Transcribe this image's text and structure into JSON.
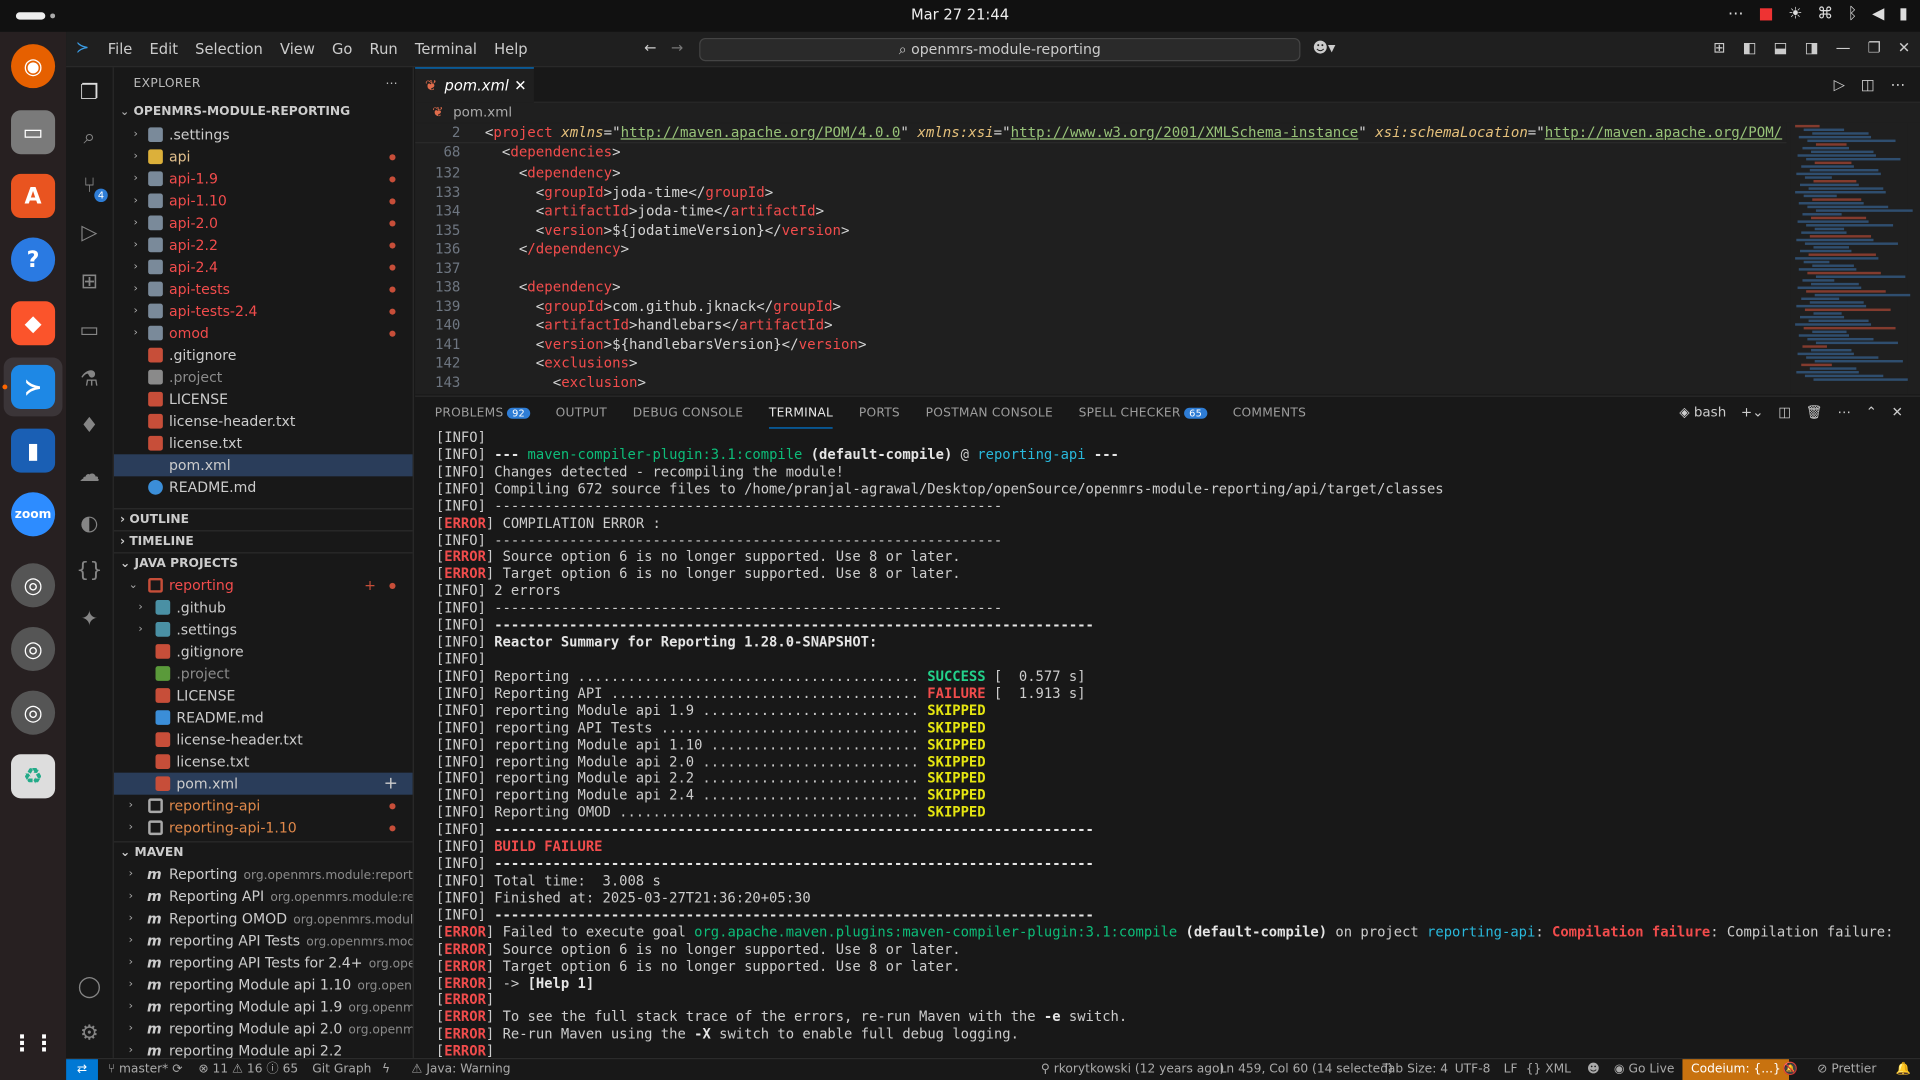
{
  "topbar": {
    "clock": "Mar 27  21:44",
    "tray_icons": [
      "more-icon",
      "record-icon",
      "brightness-icon",
      "network-icon",
      "bluetooth-icon",
      "volume-icon",
      "battery-icon"
    ]
  },
  "titlebar": {
    "menu": [
      "File",
      "Edit",
      "Selection",
      "View",
      "Go",
      "Run",
      "Terminal",
      "Help"
    ],
    "search": "openmrs-module-reporting"
  },
  "explorer": {
    "header": "EXPLORER",
    "root": "OPENMRS-MODULE-REPORTING",
    "items": [
      ".settings",
      "api",
      "api-1.9",
      "api-1.10",
      "api-2.0",
      "api-2.2",
      "api-2.4",
      "api-tests",
      "api-tests-2.4",
      "omod",
      ".gitignore",
      ".project",
      "LICENSE",
      "license-header.txt",
      "license.txt",
      "pom.xml",
      "README.md"
    ]
  },
  "sections": {
    "outline": "OUTLINE",
    "timeline": "TIMELINE",
    "java": "JAVA PROJECTS",
    "maven": "MAVEN"
  },
  "java_projects": {
    "reporting": "reporting",
    "children": [
      ".github",
      ".settings",
      ".gitignore",
      ".project",
      "LICENSE",
      "README.md",
      "license-header.txt",
      "license.txt",
      "pom.xml"
    ],
    "others": [
      "reporting-api",
      "reporting-api-1.10"
    ]
  },
  "maven": [
    {
      "name": "Reporting",
      "sub": "org.openmrs.module:reporting"
    },
    {
      "name": "Reporting API",
      "sub": "org.openmrs.module:rep..."
    },
    {
      "name": "Reporting OMOD",
      "sub": "org.openmrs.module..."
    },
    {
      "name": "reporting API Tests",
      "sub": "org.openmrs.modu..."
    },
    {
      "name": "reporting API Tests for 2.4+",
      "sub": "org.open..."
    },
    {
      "name": "reporting Module api 1.10",
      "sub": "org.openmr..."
    },
    {
      "name": "reporting Module api 1.9",
      "sub": "org.openmrs..."
    },
    {
      "name": "reporting Module api 2.0",
      "sub": "org.openmrs..."
    },
    {
      "name": "reporting Module api 2.2",
      "sub": ""
    }
  ],
  "editor": {
    "tab": "pom.xml",
    "breadcrumb": "pom.xml",
    "line2": {
      "n": "2",
      "tag": "project",
      "a1": "xmlns",
      "v1": "http://maven.apache.org/POM/4.0.0",
      "a2": "xmlns:xsi",
      "v2": "http://www.w3.org/2001/XMLSchema-instance",
      "a3": "xsi:schemaLocation",
      "v3": "http://maven.apache.org/POM/"
    },
    "lines": [
      {
        "n": "68",
        "indent": "  ",
        "tag": "dependencies",
        "text": "",
        "close": ""
      },
      {
        "n": "132",
        "indent": "    ",
        "tag": "dependency",
        "text": "",
        "close": ""
      },
      {
        "n": "133",
        "indent": "      ",
        "tag": "groupId",
        "text": "joda-time",
        "close": "groupId"
      },
      {
        "n": "134",
        "indent": "      ",
        "tag": "artifactId",
        "text": "joda-time",
        "close": "artifactId"
      },
      {
        "n": "135",
        "indent": "      ",
        "tag": "version",
        "text": "${jodatimeVersion}",
        "close": "version"
      },
      {
        "n": "136",
        "indent": "    ",
        "tag": "/dependency",
        "text": "",
        "close": ""
      },
      {
        "n": "137",
        "indent": "",
        "tag": "",
        "text": "",
        "close": ""
      },
      {
        "n": "138",
        "indent": "    ",
        "tag": "dependency",
        "text": "",
        "close": ""
      },
      {
        "n": "139",
        "indent": "      ",
        "tag": "groupId",
        "text": "com.github.jknack",
        "close": "groupId"
      },
      {
        "n": "140",
        "indent": "      ",
        "tag": "artifactId",
        "text": "handlebars",
        "close": "artifactId"
      },
      {
        "n": "141",
        "indent": "      ",
        "tag": "version",
        "text": "${handlebarsVersion}",
        "close": "version"
      },
      {
        "n": "142",
        "indent": "      ",
        "tag": "exclusions",
        "text": "",
        "close": ""
      },
      {
        "n": "143",
        "indent": "        ",
        "tag": "exclusion",
        "text": "",
        "close": ""
      }
    ]
  },
  "panel": {
    "tabs": [
      "PROBLEMS",
      "OUTPUT",
      "DEBUG CONSOLE",
      "TERMINAL",
      "PORTS",
      "POSTMAN CONSOLE",
      "SPELL CHECKER",
      "COMMENTS"
    ],
    "problems_count": "92",
    "spell_count": "65",
    "shell": "bash"
  },
  "terminal": [
    [
      [
        "",
        "[INFO]"
      ]
    ],
    [
      [
        "",
        "[INFO] "
      ],
      [
        "tB",
        "--- "
      ],
      [
        "tgr",
        "maven-compiler-plugin:3.1:compile"
      ],
      [
        "tB",
        " (default-compile)"
      ],
      [
        "",
        " @ "
      ],
      [
        "tC",
        "reporting-api"
      ],
      [
        "tB",
        " ---"
      ]
    ],
    [
      [
        "",
        "[INFO] Changes detected - recompiling the module!"
      ]
    ],
    [
      [
        "",
        "[INFO] Compiling 672 source files to /home/pranjal-agrawal/Desktop/openSource/openmrs-module-reporting/api/target/classes"
      ]
    ],
    [
      [
        "",
        "[INFO] -------------------------------------------------------------"
      ]
    ],
    [
      [
        "",
        "["
      ],
      [
        "tR",
        "ERROR"
      ],
      [
        "",
        "] COMPILATION ERROR :"
      ]
    ],
    [
      [
        "",
        "[INFO] -------------------------------------------------------------"
      ]
    ],
    [
      [
        "",
        "["
      ],
      [
        "tR",
        "ERROR"
      ],
      [
        "",
        "] Source option 6 is no longer supported. Use 8 or later."
      ]
    ],
    [
      [
        "",
        "["
      ],
      [
        "tR",
        "ERROR"
      ],
      [
        "",
        "] Target option 6 is no longer supported. Use 8 or later."
      ]
    ],
    [
      [
        "",
        "[INFO] 2 errors"
      ]
    ],
    [
      [
        "",
        "[INFO] -------------------------------------------------------------"
      ]
    ],
    [
      [
        "",
        "[INFO] "
      ],
      [
        "tB",
        "------------------------------------------------------------------------"
      ]
    ],
    [
      [
        "",
        "[INFO] "
      ],
      [
        "tB",
        "Reactor Summary for Reporting 1.28.0-SNAPSHOT:"
      ]
    ],
    [
      [
        "",
        "[INFO]"
      ]
    ],
    [
      [
        "",
        "[INFO] Reporting ......................................... "
      ],
      [
        "tG",
        "SUCCESS"
      ],
      [
        "",
        " [  0.577 s]"
      ]
    ],
    [
      [
        "",
        "[INFO] Reporting API ..................................... "
      ],
      [
        "tR",
        "FAILURE"
      ],
      [
        "",
        " [  1.913 s]"
      ]
    ],
    [
      [
        "",
        "[INFO] reporting Module api 1.9 .......................... "
      ],
      [
        "tY",
        "SKIPPED"
      ]
    ],
    [
      [
        "",
        "[INFO] reporting API Tests ............................... "
      ],
      [
        "tY",
        "SKIPPED"
      ]
    ],
    [
      [
        "",
        "[INFO] reporting Module api 1.10 ......................... "
      ],
      [
        "tY",
        "SKIPPED"
      ]
    ],
    [
      [
        "",
        "[INFO] reporting Module api 2.0 .......................... "
      ],
      [
        "tY",
        "SKIPPED"
      ]
    ],
    [
      [
        "",
        "[INFO] reporting Module api 2.2 .......................... "
      ],
      [
        "tY",
        "SKIPPED"
      ]
    ],
    [
      [
        "",
        "[INFO] reporting Module api 2.4 .......................... "
      ],
      [
        "tY",
        "SKIPPED"
      ]
    ],
    [
      [
        "",
        "[INFO] Reporting OMOD .................................... "
      ],
      [
        "tY",
        "SKIPPED"
      ]
    ],
    [
      [
        "",
        "[INFO] "
      ],
      [
        "tB",
        "------------------------------------------------------------------------"
      ]
    ],
    [
      [
        "",
        "[INFO] "
      ],
      [
        "tR",
        "BUILD FAILURE"
      ]
    ],
    [
      [
        "",
        "[INFO] "
      ],
      [
        "tB",
        "------------------------------------------------------------------------"
      ]
    ],
    [
      [
        "",
        "[INFO] Total time:  3.008 s"
      ]
    ],
    [
      [
        "",
        "[INFO] Finished at: 2025-03-27T21:36:20+05:30"
      ]
    ],
    [
      [
        "",
        "[INFO] "
      ],
      [
        "tB",
        "------------------------------------------------------------------------"
      ]
    ],
    [
      [
        "",
        "["
      ],
      [
        "tR",
        "ERROR"
      ],
      [
        "",
        "] Failed to execute goal "
      ],
      [
        "tgr",
        "org.apache.maven.plugins:maven-compiler-plugin:3.1:compile"
      ],
      [
        "tB",
        " (default-compile)"
      ],
      [
        "",
        " on project "
      ],
      [
        "tC",
        "reporting-api"
      ],
      [
        "",
        ": "
      ],
      [
        "tR",
        "Compilation failure"
      ],
      [
        "",
        ": Compilation failure:"
      ]
    ],
    [
      [
        "",
        "["
      ],
      [
        "tR",
        "ERROR"
      ],
      [
        "",
        "] Source option 6 is no longer supported. Use 8 or later."
      ]
    ],
    [
      [
        "",
        "["
      ],
      [
        "tR",
        "ERROR"
      ],
      [
        "",
        "] Target option 6 is no longer supported. Use 8 or later."
      ]
    ],
    [
      [
        "",
        "["
      ],
      [
        "tR",
        "ERROR"
      ],
      [
        "",
        "] -> "
      ],
      [
        "tB",
        "[Help 1]"
      ]
    ],
    [
      [
        "",
        "["
      ],
      [
        "tR",
        "ERROR"
      ],
      [
        "",
        "]"
      ]
    ],
    [
      [
        "",
        "["
      ],
      [
        "tR",
        "ERROR"
      ],
      [
        "",
        "] To see the full stack trace of the errors, re-run Maven with the "
      ],
      [
        "tB",
        "-e"
      ],
      [
        "",
        " switch."
      ]
    ],
    [
      [
        "",
        "["
      ],
      [
        "tR",
        "ERROR"
      ],
      [
        "",
        "] Re-run Maven using the "
      ],
      [
        "tB",
        "-X"
      ],
      [
        "",
        " switch to enable full debug logging."
      ]
    ],
    [
      [
        "",
        "["
      ],
      [
        "tR",
        "ERROR"
      ],
      [
        "",
        "]"
      ]
    ]
  ],
  "status": {
    "branch": "master*",
    "errors": "11",
    "warnings": "16",
    "info": "65",
    "git_graph": "Git Graph",
    "java": "Java: Warning",
    "blame": "rkorytkowski (12 years ago)",
    "pos": "Ln 459, Col 60 (14 selected)",
    "tab": "Tab Size: 4",
    "enc": "UTF-8",
    "eol": "LF",
    "lang": "XML",
    "golive": "Go Live",
    "codeium": "Codeium: {...}",
    "prettier": "Prettier"
  },
  "colors": {
    "accent": "#0078d4",
    "error": "#f14c4c",
    "success": "#23d18b",
    "skip": "#e5e510",
    "codeium": "#c8720f"
  }
}
